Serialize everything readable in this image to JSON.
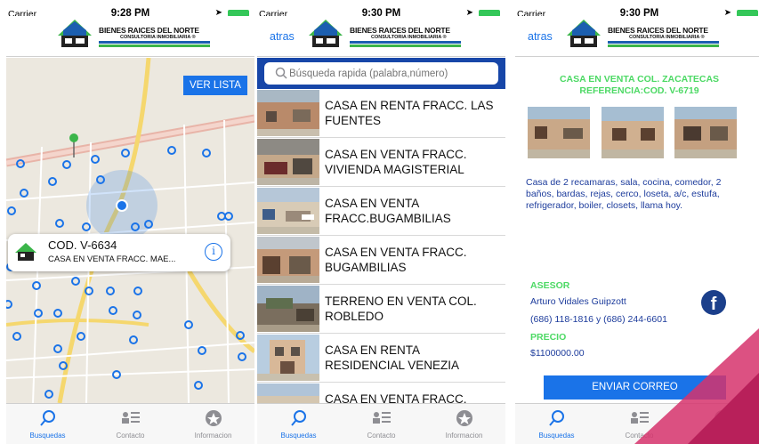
{
  "status": [
    {
      "carrier": "Carrier",
      "time": "9:28 PM"
    },
    {
      "carrier": "Carrier",
      "time": "9:30 PM"
    },
    {
      "carrier": "Carrier",
      "time": "9:30 PM"
    }
  ],
  "logo": {
    "line1": "BIENES RAICES DEL NORTE",
    "line2": "CONSULTORIA INMOBILIARIA ®"
  },
  "back_label": "atras",
  "tabs": {
    "busquedas": "Busquedas",
    "contacto": "Contacto",
    "informacion": "Informacion"
  },
  "map_screen": {
    "ver_lista": "VER LISTA",
    "callout": {
      "code": "COD. V-6634",
      "desc": "CASA EN VENTA FRACC. MAE..."
    }
  },
  "list_screen": {
    "search_placeholder": "Búsqueda rapida (palabra,número)",
    "items": [
      "CASA EN RENTA FRACC. LAS FUENTES",
      "CASA EN VENTA FRACC. VIVIENDA MAGISTERIAL",
      "CASA EN VENTA FRACC.BUGAMBILIAS",
      "CASA EN VENTA FRACC. BUGAMBILIAS",
      "TERRENO EN VENTA COL. ROBLEDO",
      "CASA EN RENTA RESIDENCIAL VENEZIA",
      "CASA EN VENTA FRACC."
    ]
  },
  "detail_screen": {
    "title_line1": "CASA EN VENTA COL. ZACATECAS",
    "title_line2": "REFERENCIA:COD. V-6719",
    "description": "Casa de 2 recamaras, sala, cocina, comedor, 2 baños, bardas, rejas, cerco, loseta, a/c, estufa, refrigerador, boiler, closets, llama hoy.",
    "asesor_label": "ASESOR",
    "asesor_name": "Arturo Vidales Guipzott",
    "phones": "(686) 118-1816 y (686) 244-6601",
    "precio_label": "PRECIO",
    "precio": "$1100000.00",
    "email_button": "ENVIAR CORREO"
  },
  "colors": {
    "accent": "#1a73e8",
    "search_bar": "#1746a8",
    "green": "#4cd964",
    "text_blue": "#1d3c9c",
    "map_bg": "#ece8df"
  }
}
